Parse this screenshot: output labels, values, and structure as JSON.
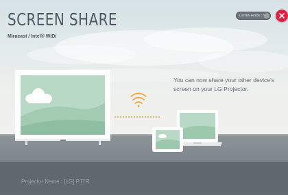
{
  "header": {
    "title": "SCREEN SHARE",
    "subtitle": "Miracast / Intel® WiDi"
  },
  "listen_mode": {
    "label": "LISTEN MODE : OFF"
  },
  "close": {
    "label": "×"
  },
  "main": {
    "message": "You can now share your other device's screen on your LG Projector."
  },
  "footer": {
    "projector_name": "Projector Name : [LG] PJTR"
  },
  "icons": {
    "close": "close-icon",
    "tv": "tv-icon",
    "wifi": "wifi-signal-icon",
    "tablet": "tablet-icon",
    "laptop": "laptop-icon",
    "cloud": "cloud-icon"
  },
  "colors": {
    "close_red": "#e3203f",
    "signal_orange": "#f2a23a",
    "title_text": "#4a5a63"
  }
}
